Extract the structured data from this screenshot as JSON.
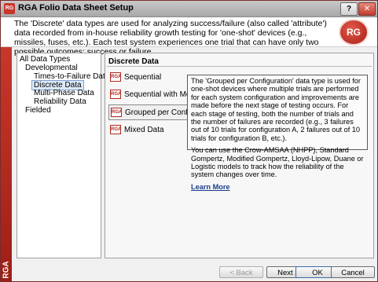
{
  "window": {
    "title": "RGA Folio Data Sheet Setup",
    "help": "?",
    "close": "✕"
  },
  "header": {
    "text": "The 'Discrete' data types are used for analyzing success/failure (also called 'attribute') data recorded from in-house reliability growth testing for 'one-shot' devices (e.g., missiles, fuses, etc.). Each test system experiences one trial that can have only two possible outcomes: success or failure.",
    "logo_text": "RG"
  },
  "sidebar_strip": {
    "label": "RGA"
  },
  "tree": {
    "items": [
      {
        "label": "All Data Types"
      },
      {
        "label": "Developmental"
      },
      {
        "label": "Times-to-Failure Data"
      },
      {
        "label": "Discrete Data"
      },
      {
        "label": "Multi-Phase Data"
      },
      {
        "label": "Reliability Data"
      },
      {
        "label": "Fielded"
      }
    ]
  },
  "panel": {
    "title": "Discrete Data",
    "options": [
      {
        "label": "Sequential",
        "icon": "RGA"
      },
      {
        "label": "Sequential with Mode",
        "icon": "RGA"
      },
      {
        "label": "Grouped per Configuration",
        "icon": "RGA"
      },
      {
        "label": "Mixed Data",
        "icon": "RGA"
      }
    ],
    "description": {
      "p1": "The 'Grouped per Configuration' data type is used for one-shot devices where multiple trials are performed for each system configuration and improvements are made before the next stage of testing occurs. For each stage of testing, both the number of trials and the number of failures are recorded (e.g., 3 failures out of 10 trials for configuration A, 2 failures out of 10 trials for configuration B, etc.).",
      "p2": "You can use the Crow-AMSAA (NHPP), Standard Gompertz, Modified Gompertz, Lloyd-Lipow, Duane or Logistic models to track how the reliability of the system changes over time.",
      "link": "Learn More"
    }
  },
  "buttons": {
    "back": "< Back",
    "next": "Next >",
    "ok": "OK",
    "cancel": "Cancel"
  },
  "colors": {
    "brand_red": "#c8372b",
    "link": "#1a3e8c"
  }
}
